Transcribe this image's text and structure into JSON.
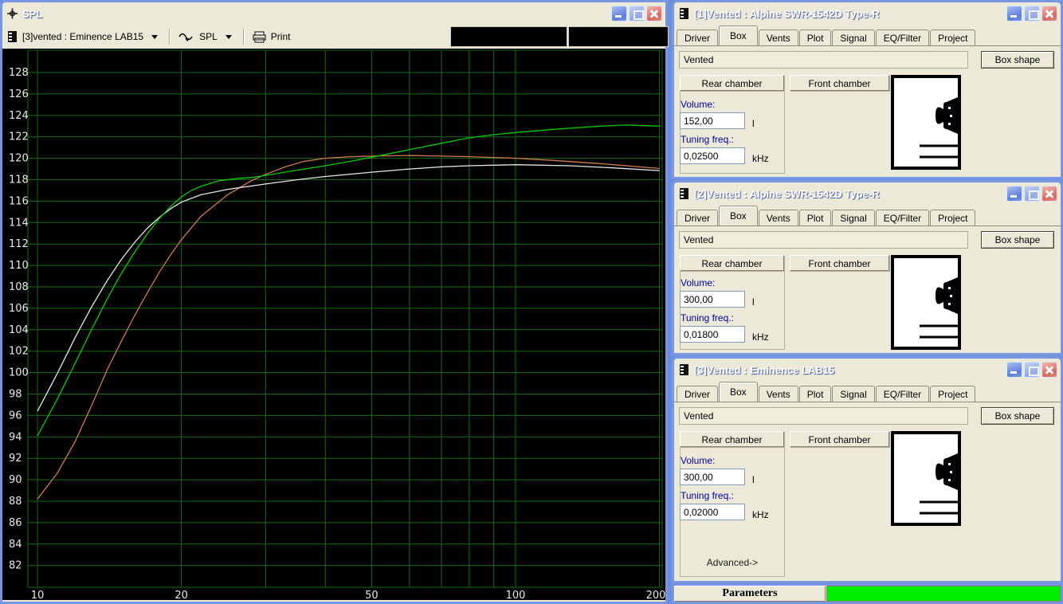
{
  "spl_window": {
    "title": "SPL",
    "toolbar": {
      "source_selector": "[3]vented : Eminence LAB15",
      "plot_type_selector": "SPL",
      "print_label": "Print"
    }
  },
  "chart_data": {
    "type": "line",
    "title": "SPL",
    "background": "#000000",
    "grid_color": "#166c16",
    "x_axis": {
      "scale": "log",
      "unit": "Hz",
      "range": [
        9.5,
        205
      ],
      "ticks": [
        10,
        20,
        50,
        100,
        200
      ],
      "gridlines": [
        10,
        20,
        30,
        40,
        50,
        60,
        70,
        80,
        90,
        100,
        200
      ]
    },
    "y_axis": {
      "unit": "dB",
      "range": [
        80,
        130
      ],
      "ticks": [
        128,
        126,
        124,
        122,
        120,
        118,
        116,
        114,
        112,
        110,
        108,
        106,
        104,
        102,
        100,
        98,
        96,
        94,
        92,
        90,
        88,
        86,
        84,
        82
      ]
    },
    "series": [
      {
        "name": "[1]Vented : Alpine SWR-1542D Type-R",
        "color": "#d2794f",
        "points": [
          [
            10,
            88.2
          ],
          [
            11,
            90.6
          ],
          [
            12,
            93.6
          ],
          [
            13,
            97.0
          ],
          [
            14,
            100.3
          ],
          [
            15,
            103.0
          ],
          [
            16,
            105.4
          ],
          [
            17,
            107.5
          ],
          [
            18,
            109.4
          ],
          [
            19,
            111.0
          ],
          [
            20,
            112.4
          ],
          [
            22,
            114.6
          ],
          [
            25,
            116.6
          ],
          [
            28,
            117.9
          ],
          [
            30,
            118.5
          ],
          [
            33,
            119.2
          ],
          [
            36,
            119.7
          ],
          [
            40,
            120.0
          ],
          [
            45,
            120.15
          ],
          [
            50,
            120.2
          ],
          [
            60,
            120.25
          ],
          [
            70,
            120.2
          ],
          [
            80,
            120.15
          ],
          [
            100,
            120.0
          ],
          [
            120,
            119.8
          ],
          [
            150,
            119.5
          ],
          [
            200,
            119.05
          ]
        ]
      },
      {
        "name": "[2]Vented : Alpine SWR-1542D Type-R",
        "color": "#e8e8e8",
        "points": [
          [
            10,
            96.4
          ],
          [
            11,
            99.9
          ],
          [
            12,
            103.3
          ],
          [
            13,
            106.2
          ],
          [
            14,
            108.6
          ],
          [
            15,
            110.6
          ],
          [
            16,
            112.2
          ],
          [
            17,
            113.5
          ],
          [
            18,
            114.5
          ],
          [
            19,
            115.3
          ],
          [
            20,
            115.9
          ],
          [
            22,
            116.6
          ],
          [
            25,
            117.1
          ],
          [
            30,
            117.6
          ],
          [
            35,
            118.0
          ],
          [
            40,
            118.3
          ],
          [
            50,
            118.7
          ],
          [
            60,
            119.0
          ],
          [
            70,
            119.2
          ],
          [
            80,
            119.3
          ],
          [
            100,
            119.4
          ],
          [
            130,
            119.3
          ],
          [
            160,
            119.1
          ],
          [
            200,
            118.85
          ]
        ]
      },
      {
        "name": "[3]Vented : Eminence LAB15",
        "color": "#00cc00",
        "points": [
          [
            10,
            94.1
          ],
          [
            11,
            97.5
          ],
          [
            12,
            100.9
          ],
          [
            13,
            104.1
          ],
          [
            14,
            106.9
          ],
          [
            15,
            109.3
          ],
          [
            16,
            111.3
          ],
          [
            17,
            113.0
          ],
          [
            18,
            114.4
          ],
          [
            19,
            115.5
          ],
          [
            20,
            116.4
          ],
          [
            21,
            117.0
          ],
          [
            22,
            117.4
          ],
          [
            24,
            117.9
          ],
          [
            26,
            118.1
          ],
          [
            28,
            118.2
          ],
          [
            30,
            118.4
          ],
          [
            35,
            118.9
          ],
          [
            40,
            119.3
          ],
          [
            45,
            119.7
          ],
          [
            50,
            120.1
          ],
          [
            60,
            120.8
          ],
          [
            70,
            121.4
          ],
          [
            80,
            121.9
          ],
          [
            90,
            122.2
          ],
          [
            100,
            122.4
          ],
          [
            120,
            122.7
          ],
          [
            150,
            123.0
          ],
          [
            170,
            123.1
          ],
          [
            200,
            123.0
          ]
        ]
      }
    ]
  },
  "windows": [
    {
      "title": "[1]Vented : Alpine SWR-1542D Type-R",
      "tabs": [
        "Driver",
        "Box",
        "Vents",
        "Plot",
        "Signal",
        "EQ/Filter",
        "Project"
      ],
      "active_tab": "Box",
      "box_type": "Vented",
      "box_shape_label": "Box shape",
      "rear_chamber_label": "Rear chamber",
      "front_chamber_label": "Front chamber",
      "volume_label": "Volume:",
      "volume_value": "152,00",
      "volume_unit": "l",
      "tuning_label": "Tuning freq.:",
      "tuning_value": "0,02500",
      "tuning_unit": "kHz"
    },
    {
      "title": "[2]Vented : Alpine SWR-1542D Type-R",
      "tabs": [
        "Driver",
        "Box",
        "Vents",
        "Plot",
        "Signal",
        "EQ/Filter",
        "Project"
      ],
      "active_tab": "Box",
      "box_type": "Vented",
      "box_shape_label": "Box shape",
      "rear_chamber_label": "Rear chamber",
      "front_chamber_label": "Front chamber",
      "volume_label": "Volume:",
      "volume_value": "300,00",
      "volume_unit": "l",
      "tuning_label": "Tuning freq.:",
      "tuning_value": "0,01800",
      "tuning_unit": "kHz"
    },
    {
      "title": "[3]Vented : Eminence LAB15",
      "tabs": [
        "Driver",
        "Box",
        "Vents",
        "Plot",
        "Signal",
        "EQ/Filter",
        "Project"
      ],
      "active_tab": "Box",
      "box_type": "Vented",
      "box_shape_label": "Box shape",
      "rear_chamber_label": "Rear chamber",
      "front_chamber_label": "Front chamber",
      "volume_label": "Volume:",
      "volume_value": "300,00",
      "volume_unit": "l",
      "tuning_label": "Tuning freq.:",
      "tuning_value": "0,02000",
      "tuning_unit": "kHz",
      "advanced_label": "Advanced->"
    }
  ],
  "status_bar": {
    "label": "Parameters",
    "progress_percent": 100,
    "progress_color": "#00f000"
  }
}
